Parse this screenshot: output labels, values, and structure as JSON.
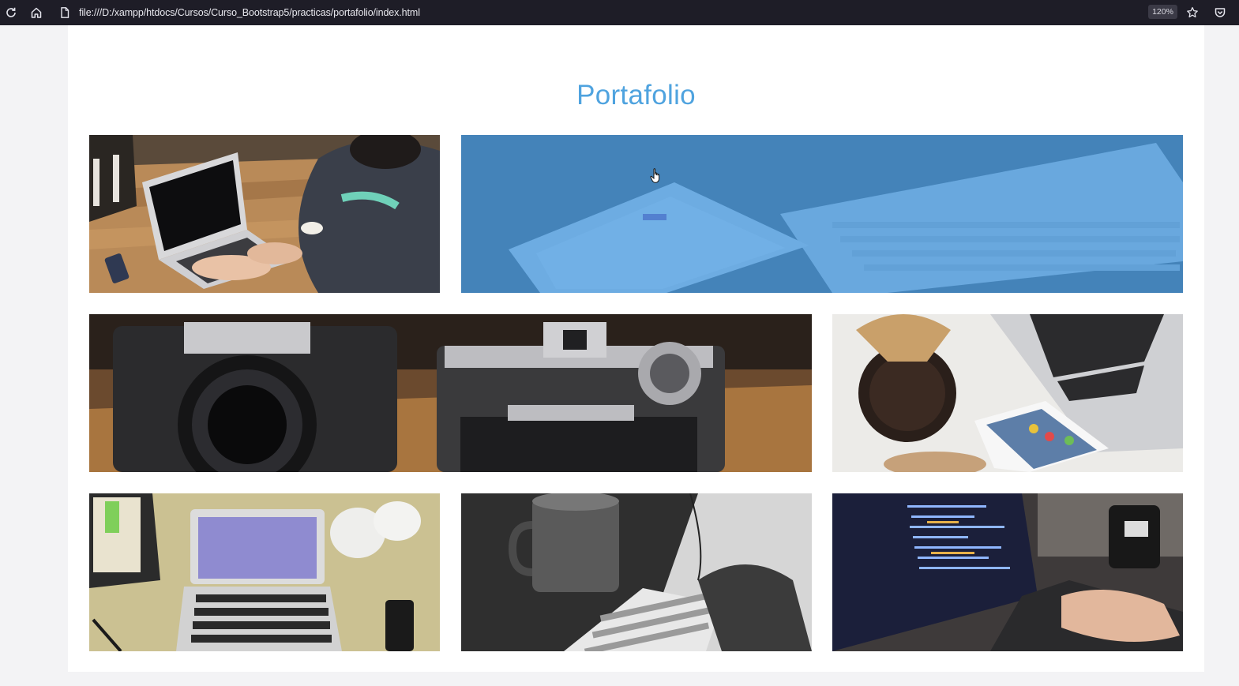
{
  "browser": {
    "url": "file:///D:/xampp/htdocs/Cursos/Curso_Bootstrap5/practicas/portafolio/index.html",
    "zoom": "120%",
    "icons": [
      "reload-icon",
      "home-icon",
      "page-icon",
      "bookmark-star-icon",
      "pocket-icon"
    ]
  },
  "page": {
    "title": "Portafolio",
    "accent_color": "#4fa3df",
    "hover_overlay_color": "#3e96e1"
  },
  "gallery": {
    "items": [
      {
        "name": "laptop-on-wooden-table",
        "hovered": false
      },
      {
        "name": "tablet-and-keyboard",
        "hovered": true
      },
      {
        "name": "vintage-cameras",
        "hovered": false
      },
      {
        "name": "coffee-phone-laptop",
        "hovered": false
      },
      {
        "name": "macbook-on-desk",
        "hovered": false
      },
      {
        "name": "mug-keyboard-mouse",
        "hovered": false
      },
      {
        "name": "coding-laptop-mug",
        "hovered": false
      }
    ]
  }
}
